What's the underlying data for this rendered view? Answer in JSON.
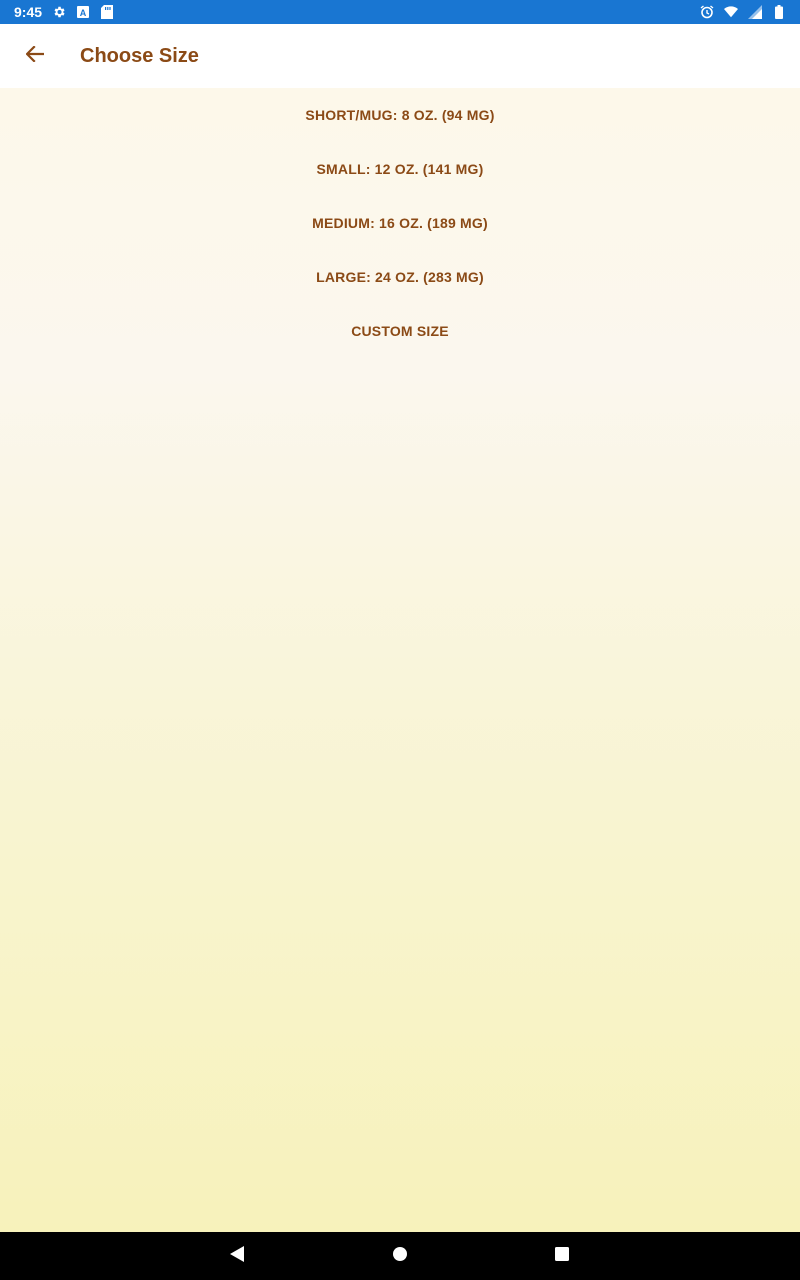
{
  "status_bar": {
    "time": "9:45",
    "left_icons": [
      "settings-icon",
      "a-icon",
      "sd-card-icon"
    ],
    "right_icons": [
      "alarm-icon",
      "wifi-icon",
      "signal-icon",
      "battery-icon"
    ]
  },
  "app_bar": {
    "title": "Choose Size",
    "back_icon": "arrow-back-icon"
  },
  "sizes": [
    {
      "label": "SHORT/MUG: 8 OZ. (94 MG)"
    },
    {
      "label": "SMALL: 12 OZ. (141 MG)"
    },
    {
      "label": "MEDIUM: 16 OZ. (189 MG)"
    },
    {
      "label": "LARGE: 24 OZ. (283 MG)"
    },
    {
      "label": "CUSTOM SIZE"
    }
  ],
  "nav_bar": {
    "back_icon": "nav-back-icon",
    "home_icon": "nav-home-icon",
    "recents_icon": "nav-recents-icon"
  },
  "colors": {
    "status_bar": "#1976d2",
    "accent_text": "#8b4a16",
    "background_top": "#fdf8ea",
    "background_bottom": "#f7f2bb"
  }
}
